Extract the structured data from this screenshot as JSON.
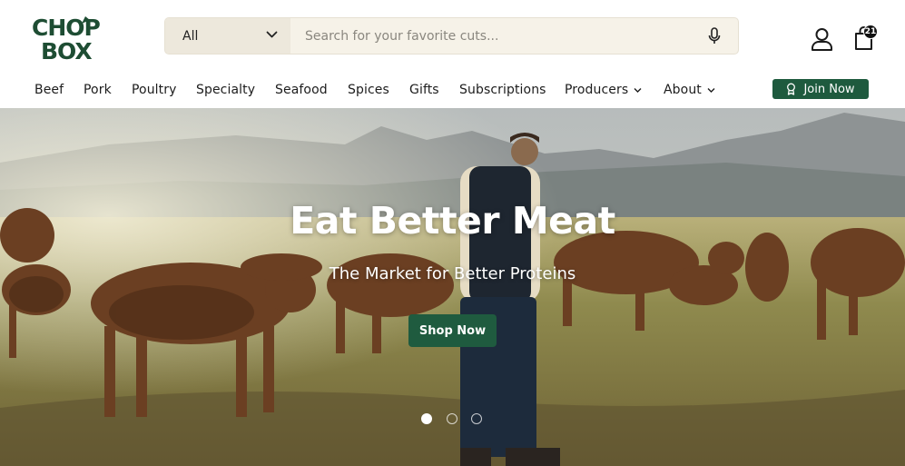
{
  "brand": {
    "logo_line1": "CHOP",
    "logo_line2": "BOX",
    "logo_color": "#1e4d33"
  },
  "search": {
    "category_value": "All",
    "placeholder": "Search for your favorite cuts...",
    "value": ""
  },
  "header_icons": {
    "account": "user-icon",
    "cart": "shopping-bag-icon",
    "cart_count": "21"
  },
  "nav": {
    "items": [
      {
        "label": "Beef"
      },
      {
        "label": "Pork"
      },
      {
        "label": "Poultry"
      },
      {
        "label": "Specialty"
      },
      {
        "label": "Seafood"
      },
      {
        "label": "Spices"
      },
      {
        "label": "Gifts"
      },
      {
        "label": "Subscriptions"
      },
      {
        "label": "Producers",
        "dropdown": true
      },
      {
        "label": "About",
        "dropdown": true
      }
    ],
    "join_label": "Join Now",
    "join_icon": "ribbon-icon"
  },
  "hero": {
    "title": "Eat Better Meat",
    "subtitle": "The Market for Better Proteins",
    "cta_label": "Shop Now",
    "slides_total": 3,
    "active_slide": 1
  },
  "colors": {
    "brand_green": "#1e5a3e",
    "search_bg": "#f6f2e8",
    "select_bg": "#ede8dc"
  }
}
